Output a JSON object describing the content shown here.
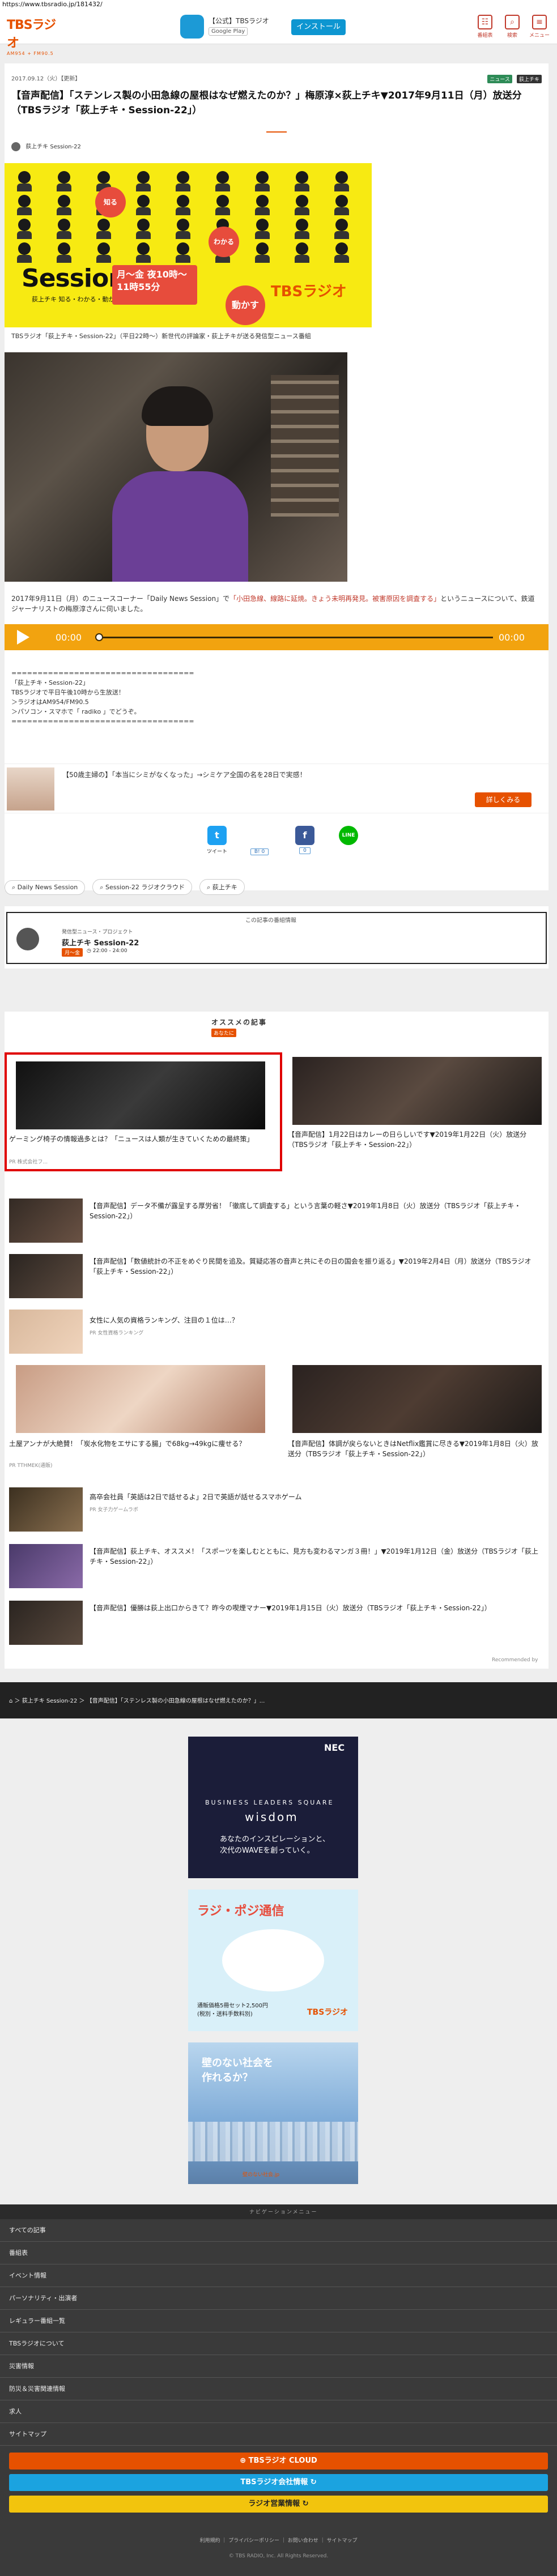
{
  "browser": {
    "url": "https://www.tbsradio.jp/181432/"
  },
  "header": {
    "logo_main": "TBSラジオ",
    "logo_sub": "AM954 + FM90.5",
    "app_name": "【公式】TBSラジオ",
    "app_store": "Google Play",
    "install_label": "インストール",
    "icons": [
      {
        "label": "番組表",
        "icon": "calendar-icon",
        "glyph": "☷"
      },
      {
        "label": "検索",
        "icon": "search-icon",
        "glyph": "⌕"
      },
      {
        "label": "メニュー",
        "icon": "menu-icon",
        "glyph": "≡"
      }
    ],
    "accent": "#c0392b"
  },
  "article": {
    "date": "2017.09.12（火）【更新】",
    "tags": [
      {
        "label": "ニュース",
        "color": "#2e8b57"
      },
      {
        "label": "荻上チキ",
        "color": "#333"
      }
    ],
    "title": "【音声配信】「ステンレス製の小田急線の屋根はなぜ燃えたのか？」梅原淳×荻上チキ▼2017年9月11日（月）放送分（TBSラジオ「荻上チキ・Session-22」）",
    "author": "荻上チキ Session-22",
    "banner": {
      "session": "Session",
      "sub": "荻上チキ 知る・わかる・動かす",
      "time": "月〜金 夜10時〜11時55分",
      "brand": "TBSラジオ",
      "b1": "知る",
      "b2": "わかる",
      "b3": "動かす"
    },
    "caption": "TBSラジオ「荻上チキ・Session-22」（平日22時〜）新世代の評論家・荻上チキが送る発信型ニュース番組",
    "body_normal": "2017年9月11日（月）のニュースコーナー「Daily News Session」で",
    "body_red": "「小田急線、線路に延焼。きょう未明再発見。被害原因を調査する」",
    "body_tail": "というニュースについて、鉄道ジャーナリストの梅原淳さんに伺いました。",
    "player": {
      "time_left": "00:00",
      "time_right": "00:00"
    },
    "info_lines": [
      "===================================",
      "「荻上チキ・Session-22」",
      "TBSラジオで平日午後10時から生放送！",
      "＞ラジオはAM954/FM90.5",
      "＞パソコン・スマホで「 radiko 」でどうぞ。",
      "==================================="
    ]
  },
  "ad_small": {
    "text": "【50歳主婦の】「本当にシミがなくなった」→シミケア全国の名を28日で実感！",
    "button": "詳しくみる"
  },
  "share": {
    "twitter": "ツイート",
    "hatena": "B!",
    "facebook": "シェア",
    "line": "LINE",
    "hatena_count": "B! 0",
    "fb_count": "0"
  },
  "chips": [
    "Daily News Session",
    "Session-22 ラジオクラウド",
    "荻上チキ"
  ],
  "program": {
    "label": "この記事の番組情報",
    "category": "発信型ニュース・プロジェクト",
    "name": "荻上チキ Session-22",
    "badge": "月〜金",
    "time": "22:00 - 24:00"
  },
  "recommend": {
    "title": "オススメの記事",
    "label": "あなたに",
    "footer": "Recommended by",
    "items": [
      {
        "text": "ゲーミング椅子の情報過多とは？「ニュースは人類が生きていくための最終策」",
        "src": "PR 株式会社フ..."
      },
      {
        "text": "【音声配信】1月22日はカレーの日らしいです▼2019年1月22日（火）放送分（TBSラジオ「荻上チキ・Session-22」）",
        "src": ""
      },
      {
        "text": "【音声配信】データ不備が露呈する厚労省！「徹底して調査する」という言葉の軽さ▼2019年1月8日（火）放送分（TBSラジオ「荻上チキ・Session-22」）",
        "src": ""
      },
      {
        "text": "【音声配信】「数値統計の不正をめぐり民間を追及。質疑応答の音声と共にその日の国会を振り返る」▼2019年2月4日（月）放送分（TBSラジオ「荻上チキ・Session-22」）",
        "src": ""
      },
      {
        "text": "女性に人気の資格ランキング、注目の１位は…？",
        "src": "PR 女性資格ランキング"
      },
      {
        "text": "土屋アンナが大絶賛！「炭水化物をエサにする腸」で68kg→49kgに痩せる？",
        "src": "PR TTHMEK(通販)"
      },
      {
        "text": "【音声配信】体調が戻らないときはNetflix鑑賞に尽きる▼2019年1月8日（火）放送分（TBSラジオ「荻上チキ・Session-22」）",
        "src": ""
      },
      {
        "text": "高卒会社員「英語は2日で話せるよ」2日で英語が話せるスマホゲーム",
        "src": "PR 女子力ゲームラボ"
      },
      {
        "text": "【音声配信】荻上チキ、オススメ！「スポーツを楽しむとともに、見方も変わるマンガ３冊！」▼2019年1月12日（金）放送分（TBSラジオ「荻上チキ・Session-22」）",
        "src": ""
      },
      {
        "text": "【音声配信】優勝は荻上出口からきて？昨今の喫煙マナー▼2019年1月15日（火）放送分（TBSラジオ「荻上チキ・Session-22」）",
        "src": ""
      }
    ]
  },
  "breadcrumb": {
    "text": "⌂ ＞ 荻上チキ Session-22 ＞ 【音声配信】「ステンレス製の小田急線の屋根はなぜ燃えたのか？」..."
  },
  "ads": {
    "nec_brand": "NEC",
    "nec_bls": "BUSINESS LEADERS SQUARE",
    "nec_wisdom": "wisdom",
    "nec_msg1": "あなたのインスピレーションと、",
    "nec_msg2": "次代のWAVEを創っていく。",
    "radio_title": "ラジ・ポジ通信",
    "radio_text1": "通販価格5冊セット2,500円",
    "radio_text2": "(税別・送料手数料別)",
    "radio_brand": "TBSラジオ",
    "society_l1": "壁のない社会を",
    "society_l2": "作れるか？",
    "society_foot": "壁のない社会.jp"
  },
  "footer": {
    "header": "ナビゲーションメニュー",
    "items": [
      "すべての記事",
      "番組表",
      "イベント情報",
      "パーソナリティ・出演者",
      "レギュラー番組一覧",
      "TBSラジオについて",
      "災害情報",
      "防災＆災害関連情報",
      "求人",
      "サイトマップ"
    ],
    "btn1": "⊕ TBSラジオ CLOUD",
    "btn2": "TBSラジオ会社情報 ↻",
    "btn3": "ラジオ営業情報 ↻",
    "links": "利用規約 ｜ プライバシーポリシー ｜ お問い合わせ ｜ サイトマップ",
    "copy": "© TBS RADIO, Inc. All Rights Reserved."
  }
}
